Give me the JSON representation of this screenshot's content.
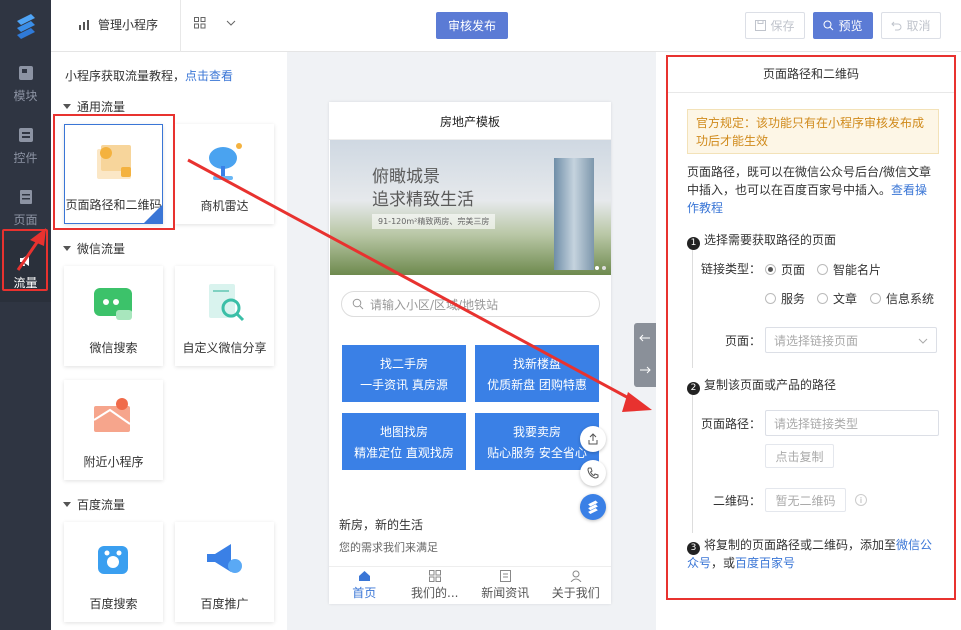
{
  "header": {
    "manage_label": "管理小程序",
    "publish_label": "审核发布",
    "save_label": "保存",
    "preview_label": "预览",
    "undo_label": "取消"
  },
  "leftnav": {
    "items": [
      {
        "label": "模块"
      },
      {
        "label": "控件"
      },
      {
        "label": "页面"
      },
      {
        "label": "流量"
      }
    ]
  },
  "leftpanel": {
    "tip_text": "小程序获取流量教程，",
    "tip_link": "点击查看",
    "sections": [
      {
        "title": "通用流量",
        "items": [
          "页面路径和二维码",
          "商机雷达"
        ]
      },
      {
        "title": "微信流量",
        "items": [
          "微信搜索",
          "自定义微信分享",
          "附近小程序"
        ]
      },
      {
        "title": "百度流量",
        "items": [
          "百度搜索",
          "百度推广"
        ]
      }
    ]
  },
  "phone": {
    "title": "房地产模板",
    "banner_line1": "俯瞰城景",
    "banner_line2": "追求精致生活",
    "banner_sub": "91-120m²精致两房、完美三房",
    "search_placeholder": "请输入小区/区域/地铁站",
    "buttons": [
      {
        "title": "找二手房",
        "sub": "一手资讯 真房源"
      },
      {
        "title": "找新楼盘",
        "sub": "优质新盘 团购特惠"
      },
      {
        "title": "地图找房",
        "sub": "精准定位 直观找房"
      },
      {
        "title": "我要卖房",
        "sub": "贴心服务 安全省心"
      }
    ],
    "text1": "新房，新的生活",
    "text2": "您的需求我们来满足",
    "tabs": [
      "首页",
      "我们的...",
      "新闻资讯",
      "关于我们"
    ]
  },
  "rightpanel": {
    "title": "页面路径和二维码",
    "notice": "官方规定：该功能只有在小程序审核发布成功后才能生效",
    "desc": "页面路径，既可以在微信公众号后台/微信文章中插入，也可以在百度百家号中插入。",
    "desc_link": "查看操作教程",
    "step1": "选择需要获取路径的页面",
    "link_type_label": "链接类型：",
    "radios": [
      "页面",
      "智能名片",
      "服务",
      "文章",
      "信息系统"
    ],
    "page_label": "页面：",
    "page_placeholder": "请选择链接页面",
    "step2": "复制该页面或产品的路径",
    "path_label": "页面路径：",
    "path_placeholder": "请选择链接类型",
    "copy_label": "点击复制",
    "qr_label": "二维码：",
    "qr_placeholder": "暂无二维码",
    "step3_pre": "将复制的页面路径或二维码，添加至",
    "step3_link1": "微信公众号",
    "step3_mid": "，或",
    "step3_link2": "百度百家号"
  },
  "colors": {
    "accent": "#3a76d6",
    "primary_button": "#5b7bd5",
    "annotation_red": "#e8322f",
    "nav_bg": "#2f3542"
  }
}
